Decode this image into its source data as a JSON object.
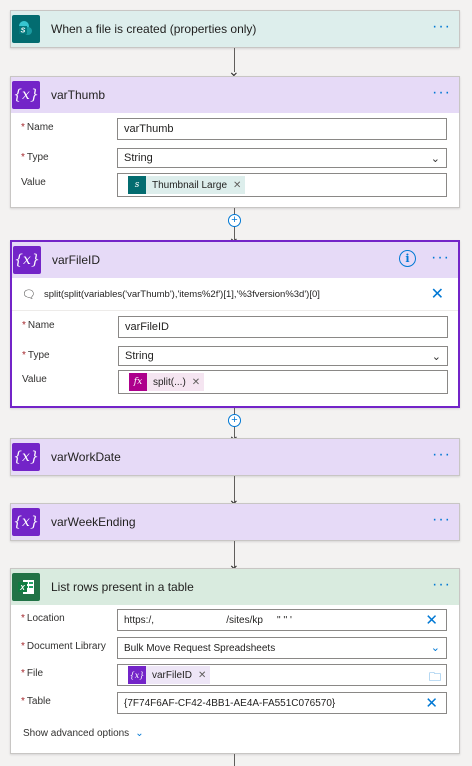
{
  "trigger": {
    "title": "When a file is created (properties only)",
    "icon": "sharepoint-icon"
  },
  "varThumb": {
    "title": "varThumb",
    "name_label": "Name",
    "name_value": "varThumb",
    "type_label": "Type",
    "type_value": "String",
    "value_label": "Value",
    "value_token": "Thumbnail Large",
    "icon": "variable-icon"
  },
  "varFileID": {
    "title": "varFileID",
    "expression": "split(split(variables('varThumb'),'items%2f')[1],'%3fversion%3d')[0]",
    "name_label": "Name",
    "name_value": "varFileID",
    "type_label": "Type",
    "type_value": "String",
    "value_label": "Value",
    "value_token": "split(...)",
    "icon": "variable-icon"
  },
  "varWorkDate": {
    "title": "varWorkDate",
    "icon": "variable-icon"
  },
  "varWeekEnding": {
    "title": "varWeekEnding",
    "icon": "variable-icon"
  },
  "listRows": {
    "title": "List rows present in a table",
    "location_label": "Location",
    "location_value": "https:/,                          /sites/kp     '' '' '",
    "library_label": "Document Library",
    "library_value": "Bulk Move Request Spreadsheets",
    "file_label": "File",
    "file_token": "varFileID",
    "table_label": "Table",
    "table_value": "{7F74F6AF-CF42-4BB1-AE4A-FA551C076570}",
    "advanced_label": "Show advanced options",
    "icon": "excel-icon"
  },
  "colors": {
    "accent": "#0078d4",
    "variable": "#7324c8",
    "variable_header": "#e6daf7",
    "excel": "#217346",
    "sharepoint": "#036c70"
  }
}
